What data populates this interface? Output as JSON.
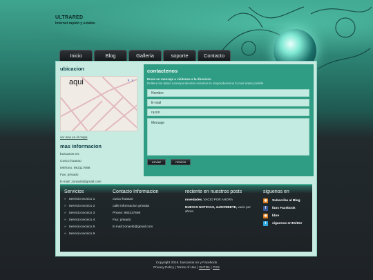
{
  "brand": {
    "name": "ULTRARED",
    "tagline": "Internet rapido y estable"
  },
  "nav": [
    "Inicio",
    "Blog",
    "Galleria",
    "soporte",
    "Contacto"
  ],
  "location": {
    "title": "ubicacion",
    "map_label": "aqui",
    "map_link": "ver mas en el mapa",
    "info_title": "mas informacion",
    "info": [
      "buscanos en:",
      "Cusco,huasao",
      "telefono: 983117698",
      "Fax: privado",
      "E-mail: zonavib@gmail.com"
    ]
  },
  "contact": {
    "title": "contactenos",
    "line1": "Envie un mensaje o visitenos a la direccion",
    "line2": "Rellene los datos correspondientes nosotros lo responderemos lo mas antes posible",
    "fields": [
      "Nombre",
      "E-mail",
      "razon"
    ],
    "message_placeholder": "Mensaje",
    "send": "enviar",
    "reset": "reinicio"
  },
  "footer": {
    "services_title": "Servicios",
    "services": [
      "Servicio tecnico 1",
      "Servicio tecnico 2",
      "Servicio tecnico 3",
      "Servicio tecnico 4",
      "Servicio tecnico 5",
      "Servicio tecnico 6"
    ],
    "contact_title": "Contacto Informacion",
    "contact": [
      "cusco huasao",
      "calle informacion privada",
      "Phone: 983117698",
      "Fax: privado",
      "E-mail:zonavib@gmail.com"
    ],
    "news_title": "reciente en nuestros posts",
    "news1_bold": "novedades.",
    "news1_rest": " VACIO POR AHORA",
    "news2_bold": "NUEVAS NOTICIAS, sUSCRIBETE,",
    "news2_rest": " vacio por ahora",
    "follow_title": "siguenos en",
    "follow": [
      "Subscribe al Blog",
      "fans Facebook",
      "libre",
      "siguenos enTwitter"
    ]
  },
  "copyright": {
    "line1": "Copyright 2016. buscanos en y Facebook",
    "privacy": "Privacy Policy",
    "sep": " | ",
    "terms": "Terms of Use",
    "xhtml": "XHTML",
    "css": "CSS"
  },
  "colors": {
    "accent": "#2f9c84",
    "panel": "#c8ebe1",
    "dark": "#1e2226"
  }
}
